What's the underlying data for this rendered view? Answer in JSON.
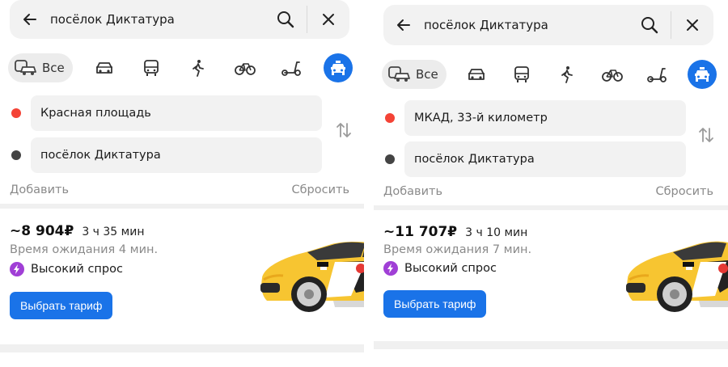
{
  "panels": [
    {
      "search": {
        "query": "посёлок Диктатура"
      },
      "modes": {
        "all_label": "Все"
      },
      "route": {
        "from": "Красная площадь",
        "to": "посёлок Диктатура"
      },
      "links": {
        "add": "Добавить",
        "reset": "Сбросить"
      },
      "offer": {
        "price": "~8 904₽",
        "duration": "3 ч 35 мин",
        "wait": "Время ожидания 4 мин.",
        "demand": "Высокий спрос",
        "button": "Выбрать тариф"
      }
    },
    {
      "search": {
        "query": "посёлок Диктатура"
      },
      "modes": {
        "all_label": "Все"
      },
      "route": {
        "from": "МКАД, 33-й километр",
        "to": "посёлок Диктатура"
      },
      "links": {
        "add": "Добавить",
        "reset": "Сбросить"
      },
      "offer": {
        "price": "~11 707₽",
        "duration": "3 ч 10 мин",
        "wait": "Время ожидания 7 мин.",
        "demand": "Высокий спрос",
        "button": "Выбрать тариф"
      }
    }
  ],
  "icons": [
    "back-arrow-icon",
    "search-icon",
    "close-icon",
    "all-transport-icon",
    "car-icon",
    "bus-icon",
    "walk-icon",
    "bicycle-icon",
    "scooter-icon",
    "taxi-icon",
    "swap-icon",
    "lightning-icon",
    "taxi-car-image"
  ],
  "colors": {
    "accent": "#1a73e8",
    "from_dot": "#f44336",
    "to_dot": "#444444",
    "demand": "#a03fd6",
    "taxi_yellow": "#f7c531"
  }
}
